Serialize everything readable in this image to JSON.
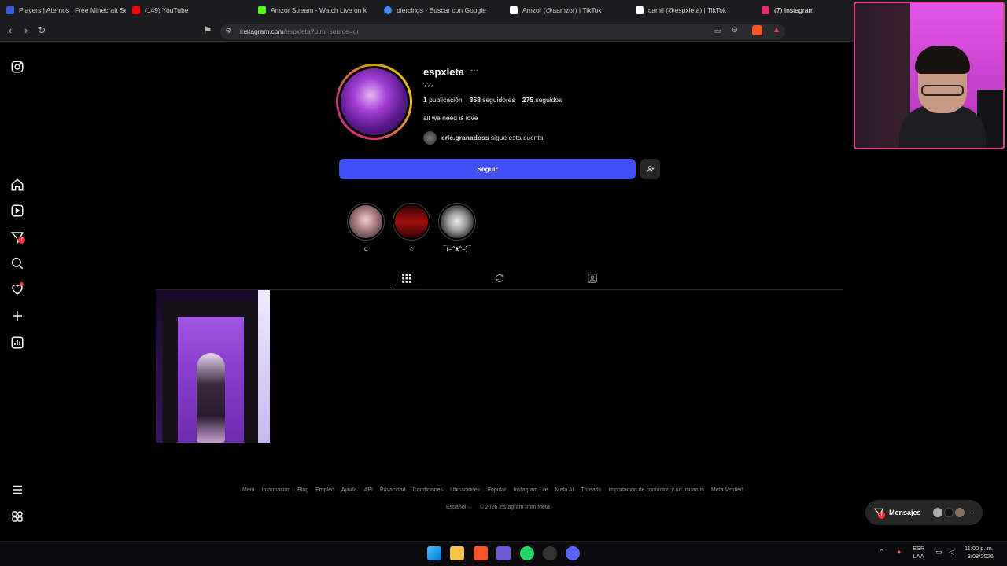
{
  "browser": {
    "tabs": [
      {
        "title": "Players | Aternos | Free Minecraft Se",
        "color": "#3b5bdb"
      },
      {
        "title": "(149) YouTube",
        "color": "#ff0000"
      },
      {
        "title": "Amzor Stream - Watch Live on k",
        "color": "#53fc18"
      },
      {
        "title": "piercings - Buscar con Google",
        "color": "#4285f4"
      },
      {
        "title": "Amzor (@aamzor) | TikTok",
        "color": "#ffffff"
      },
      {
        "title": "camil (@espxleta) | TikTok",
        "color": "#ffffff"
      },
      {
        "title": "(7) Instagram",
        "color": "#e1306c"
      }
    ],
    "url_main": "instagram.com",
    "url_rest": "/espxleta?utm_source=qr"
  },
  "sidebar": {
    "icons": [
      "instagram-icon",
      "home-icon",
      "reels-icon",
      "messages-icon",
      "search-icon",
      "notifications-icon",
      "create-icon",
      "dashboard-icon",
      "menu-icon",
      "more-icon"
    ],
    "messages_badge": "7"
  },
  "profile": {
    "username": "espxleta",
    "more": "···",
    "pronoun": "???",
    "posts_count": "1",
    "posts_label": "publicación",
    "followers_count": "358",
    "followers_label": "seguidores",
    "following_count": "275",
    "following_label": "seguidos",
    "bio": "all we need is love",
    "followed_by_user": "eric.granadoss",
    "followed_by_text": "sigue esta cuenta",
    "follow_button": "Seguir"
  },
  "highlights": [
    {
      "label": "c"
    },
    {
      "label": "☃"
    },
    {
      "label": "¯(=^ᴥ^=)¯"
    }
  ],
  "footer": {
    "links": [
      "Meta",
      "Información",
      "Blog",
      "Empleo",
      "Ayuda",
      "API",
      "Privacidad",
      "Condiciones",
      "Ubicaciones",
      "Popular",
      "Instagram Lite",
      "Meta AI",
      "Threads",
      "Importación de contactos y no usuarios",
      "Meta Verified"
    ],
    "language": "Español ⌵",
    "copyright": "© 2026 Instagram from Meta"
  },
  "messages_widget": {
    "label": "Mensajes",
    "badge": "7",
    "more": "···"
  },
  "taskbar": {
    "lang_top": "ESP",
    "lang_bottom": "LAA",
    "time": "11:00 p. m.",
    "date": "3/08/2026"
  }
}
